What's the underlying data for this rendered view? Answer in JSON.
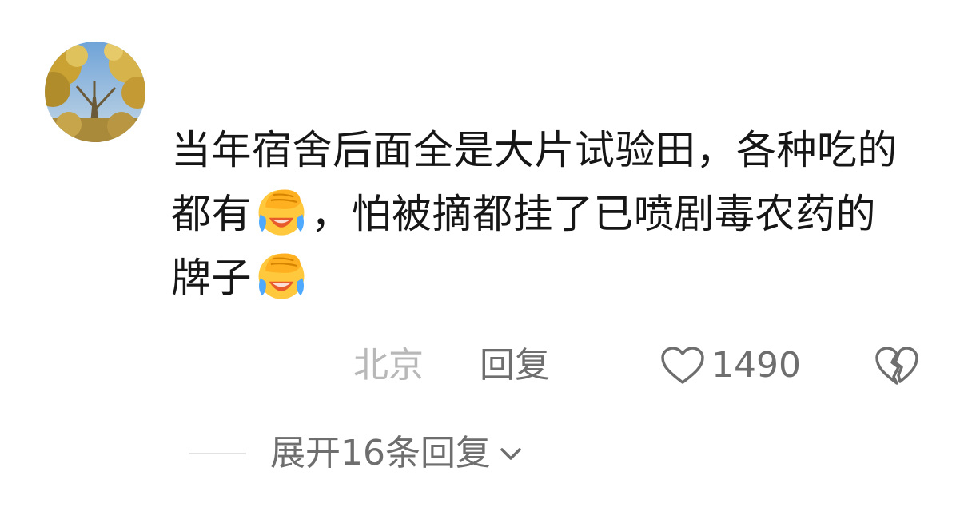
{
  "comment": {
    "text_part1": "当年宿舍后面全是大片试验田，各种吃的都有",
    "text_part2": "，怕被摘都挂了已喷剧毒农药的牌子",
    "emoji": "face-palm-crying-laughing",
    "location": "北京",
    "reply_label": "回复",
    "like_count": "1490",
    "expand_label": "展开16条回复"
  },
  "colors": {
    "text": "#161616",
    "location": "#b8b8b8",
    "secondary": "#6e6e6e",
    "emoji_face": "#ffc83d",
    "emoji_tears": "#4fa9ff",
    "emoji_mouth": "#e85a2a"
  }
}
